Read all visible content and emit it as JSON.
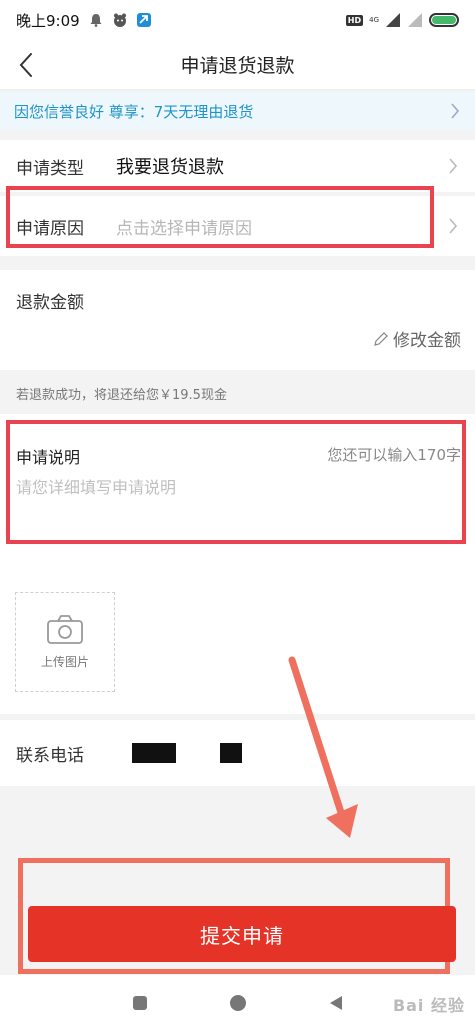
{
  "status_bar": {
    "time": "晚上9:09",
    "hd": "HD",
    "network": "4G"
  },
  "nav": {
    "title": "申请退货退款"
  },
  "notice": {
    "text": "因您信誉良好 尊享：7天无理由退货"
  },
  "apply_type": {
    "label": "申请类型",
    "value": "我要退货退款"
  },
  "apply_reason": {
    "label": "申请原因",
    "placeholder": "点击选择申请原因"
  },
  "refund_amount": {
    "label": "退款金额",
    "modify_label": "修改金额"
  },
  "refund_note": "若退款成功，将退还给您￥19.5现金",
  "explain": {
    "title": "申请说明",
    "counter": "您还可以输入170字",
    "placeholder": "请您详细填写申请说明"
  },
  "upload": {
    "label": "上传图片"
  },
  "contact": {
    "label": "联系电话"
  },
  "submit": {
    "label": "提交申请"
  },
  "watermark": "Bai 经验",
  "colors": {
    "accent": "#e63328",
    "annotation": "#ea4350",
    "notice_text": "#1e94c9",
    "arrow": "#f07060"
  }
}
